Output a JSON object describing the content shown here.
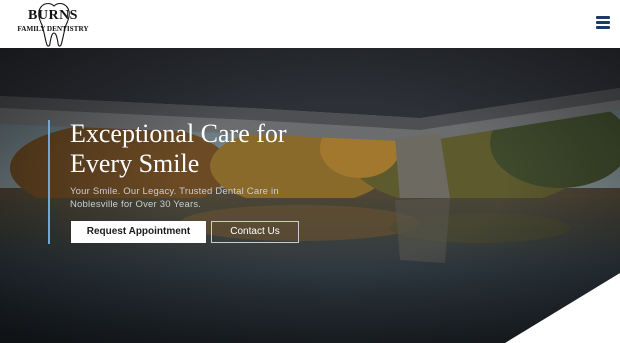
{
  "header": {
    "logo": {
      "name": "BURNS",
      "subtitle": "FAMILY DENTISTRY"
    },
    "menu_icon": "hamburger-menu-icon"
  },
  "hero": {
    "title_line1": "Exceptional Care for",
    "title_line2": "Every Smile",
    "subtitle_line1": "Your Smile. Our Legacy. Trusted Dental Care in",
    "subtitle_line2": "Noblesville for Over 30 Years.",
    "primary_button": "Request Appointment",
    "secondary_button": "Contact Us"
  },
  "colors": {
    "accent_bar": "#6fa8d8",
    "menu_icon": "#1b3a66",
    "header_bg": "#ffffff"
  }
}
